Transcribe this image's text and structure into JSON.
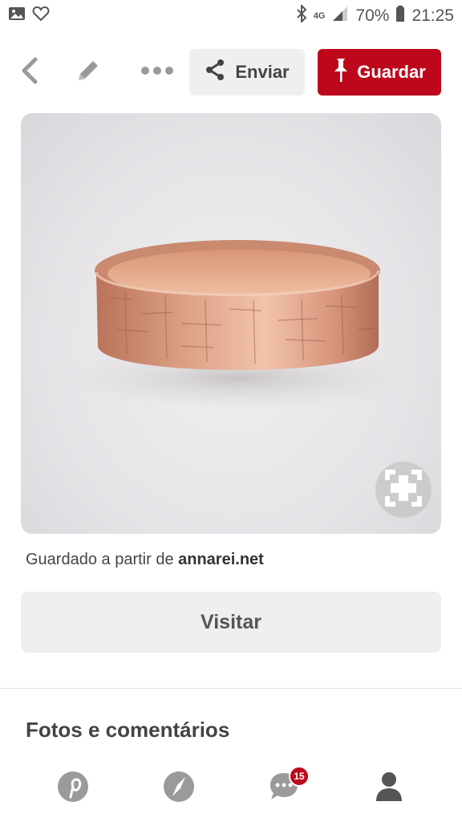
{
  "status_bar": {
    "network": "4G",
    "battery": "70%",
    "time": "21:25",
    "icons": [
      "gallery-icon",
      "heart-outline-icon",
      "bluetooth-icon",
      "signal-icon",
      "battery-icon"
    ]
  },
  "action_bar": {
    "send_label": "Enviar",
    "save_label": "Guardar",
    "icons": [
      "chevron-left-icon",
      "pencil-icon",
      "more-icon",
      "share-icon",
      "pin-icon"
    ]
  },
  "pin": {
    "image_subject": "rose gold hammered ring",
    "source_prefix": "Guardado a partir de ",
    "source_domain": "annarei.net",
    "visit_label": "Visitar"
  },
  "section": {
    "title": "Fotos e comentários"
  },
  "bottom_nav": {
    "items": [
      "pinterest-icon",
      "compass-icon",
      "chat-icon",
      "profile-icon"
    ],
    "notifications_count": "15"
  },
  "colors": {
    "brand_red": "#bd081c",
    "button_gray": "#efefef",
    "icon_gray": "#9a9a9a"
  }
}
